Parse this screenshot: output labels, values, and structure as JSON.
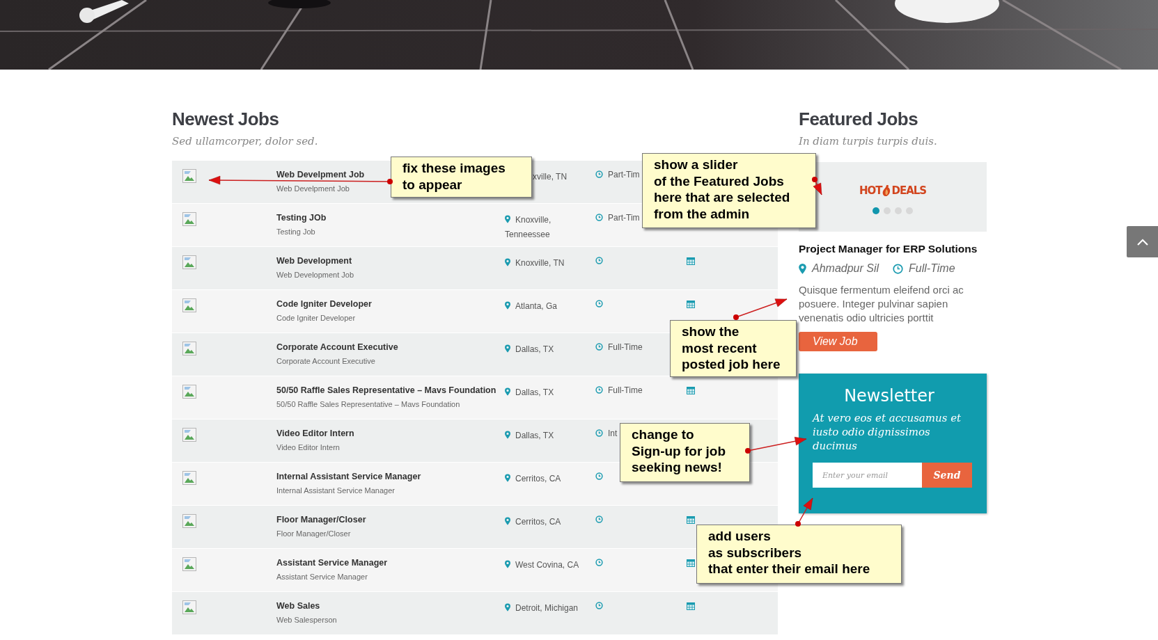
{
  "newest": {
    "title": "Newest Jobs",
    "subtitle": "Sed ullamcorper, dolor sed.",
    "rows": [
      {
        "title": "Web Develpment Job",
        "subtitle": "Web Develpment Job",
        "pin_icon": false,
        "location": "xville, TN",
        "type": "Part-Tim",
        "calendar_icon": false
      },
      {
        "title": "Testing JOb",
        "subtitle": "Testing Job",
        "pin_icon": true,
        "location": "Knoxville, Tenneessee",
        "type": "Part-Tim",
        "calendar_icon": false
      },
      {
        "title": "Web Development",
        "subtitle": "Web Development Job",
        "pin_icon": true,
        "location": "Knoxville, TN",
        "calendar_icon": true
      },
      {
        "title": "Code Igniter Developer",
        "subtitle": "Code Igniter Developer",
        "pin_icon": true,
        "location": "Atlanta, Ga",
        "calendar_icon": true
      },
      {
        "title": "Corporate Account Executive",
        "subtitle": "Corporate Account Executive",
        "pin_icon": true,
        "location": "Dallas, TX",
        "type": "Full-Time",
        "calendar_icon": false
      },
      {
        "title": "50/50 Raffle Sales Representative – Mavs Foundation",
        "subtitle": "50/50 Raffle Sales Representative – Mavs Foundation",
        "pin_icon": true,
        "location": "Dallas, TX",
        "type": "Full-Time",
        "calendar_icon": true
      },
      {
        "title": "Video Editor Intern",
        "subtitle": "Video Editor Intern",
        "pin_icon": true,
        "location": "Dallas, TX",
        "type": "Int",
        "calendar_icon": false
      },
      {
        "title": "Internal Assistant Service Manager",
        "subtitle": "Internal Assistant Service Manager",
        "pin_icon": true,
        "location": "Cerritos, CA",
        "calendar_icon": false
      },
      {
        "title": "Floor Manager/Closer",
        "subtitle": "Floor Manager/Closer",
        "pin_icon": true,
        "location": "Cerritos, CA",
        "calendar_icon": true
      },
      {
        "title": "Assistant Service Manager",
        "subtitle": "Assistant Service Manager",
        "pin_icon": true,
        "location": "West Covina, CA",
        "calendar_icon": true
      },
      {
        "title": "Web Sales",
        "subtitle": "Web Salesperson",
        "pin_icon": true,
        "location": "Detroit, Michigan",
        "calendar_icon": true
      }
    ]
  },
  "featured": {
    "title": "Featured Jobs",
    "subtitle": "In diam turpis turpis duis.",
    "logo": {
      "left": "HOT",
      "right": "DEALS"
    },
    "dots": [
      {
        "selected": true
      },
      {
        "selected": false
      },
      {
        "selected": false
      },
      {
        "selected": false
      }
    ],
    "job_title": "Project Manager for ERP Solutions",
    "location": "Ahmadpur Sil",
    "type": "Full-Time",
    "description": "Quisque fermentum eleifend orci ac posuere. Integer pulvinar sapien venenatis odio ultricies porttit",
    "button": "View Job"
  },
  "newsletter": {
    "title": "Newsletter",
    "text": "At vero eos et accusamus et iusto odio dignissimos ducimus",
    "placeholder": "Enter your email",
    "button": "Send"
  },
  "annotations": [
    {
      "lines": [
        "fix these images",
        "to appear"
      ]
    },
    {
      "lines": [
        "show a slider",
        "of the Featured Jobs",
        "here that are selected",
        "from the admin"
      ]
    },
    {
      "lines": [
        "show the",
        "most recent",
        "posted job here"
      ]
    },
    {
      "lines": [
        "change to",
        "Sign-up for job",
        "seeking news!"
      ]
    },
    {
      "lines": [
        "add users",
        "as subscribers",
        "that enter their email here"
      ]
    }
  ]
}
